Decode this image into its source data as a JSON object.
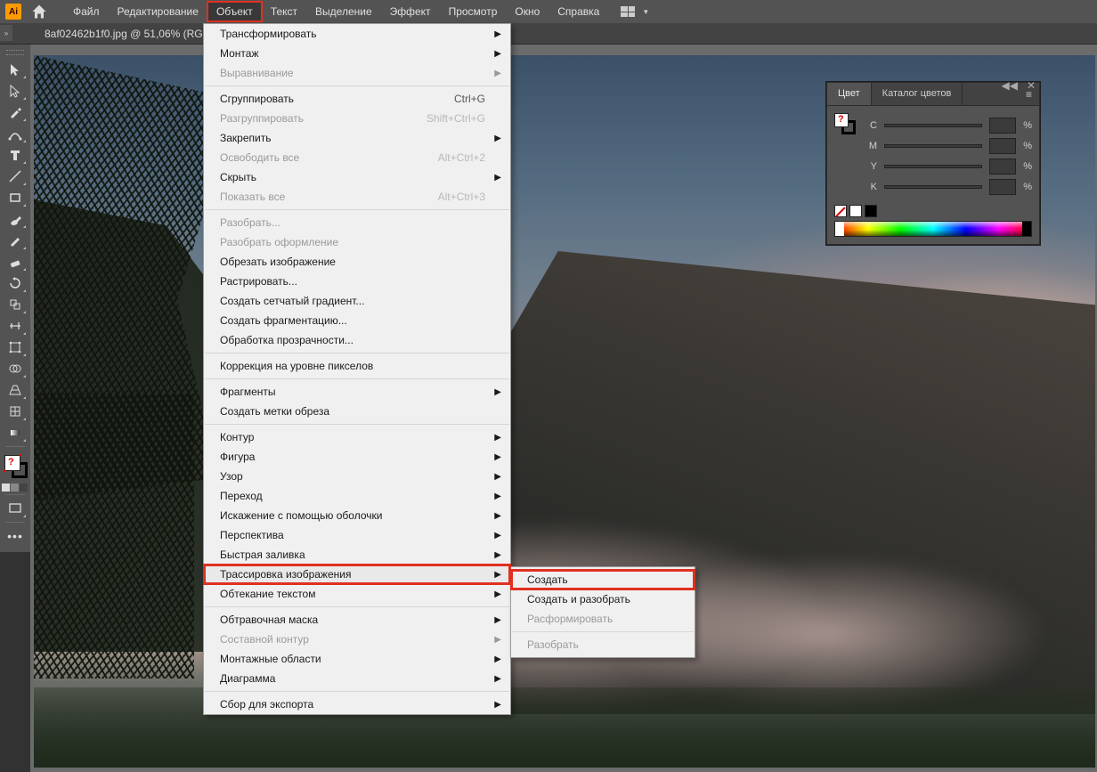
{
  "menubar": {
    "items": [
      "Файл",
      "Редактирование",
      "Объект",
      "Текст",
      "Выделение",
      "Эффект",
      "Просмотр",
      "Окно",
      "Справка"
    ],
    "active_index": 2
  },
  "document": {
    "tab_title": "8af02462b1f0.jpg @ 51,06% (RGB/"
  },
  "object_menu": {
    "groups": [
      [
        {
          "label": "Трансформировать",
          "submenu": true
        },
        {
          "label": "Монтаж",
          "submenu": true
        },
        {
          "label": "Выравнивание",
          "submenu": true,
          "disabled": true
        }
      ],
      [
        {
          "label": "Сгруппировать",
          "shortcut": "Ctrl+G"
        },
        {
          "label": "Разгруппировать",
          "shortcut": "Shift+Ctrl+G",
          "disabled": true
        },
        {
          "label": "Закрепить",
          "submenu": true
        },
        {
          "label": "Освободить все",
          "shortcut": "Alt+Ctrl+2",
          "disabled": true
        },
        {
          "label": "Скрыть",
          "submenu": true
        },
        {
          "label": "Показать все",
          "shortcut": "Alt+Ctrl+3",
          "disabled": true
        }
      ],
      [
        {
          "label": "Разобрать...",
          "disabled": true
        },
        {
          "label": "Разобрать оформление",
          "disabled": true
        },
        {
          "label": "Обрезать изображение"
        },
        {
          "label": "Растрировать..."
        },
        {
          "label": "Создать сетчатый градиент..."
        },
        {
          "label": "Создать фрагментацию..."
        },
        {
          "label": "Обработка прозрачности..."
        }
      ],
      [
        {
          "label": "Коррекция на уровне пикселов"
        }
      ],
      [
        {
          "label": "Фрагменты",
          "submenu": true
        },
        {
          "label": "Создать метки обреза"
        }
      ],
      [
        {
          "label": "Контур",
          "submenu": true
        },
        {
          "label": "Фигура",
          "submenu": true
        },
        {
          "label": "Узор",
          "submenu": true
        },
        {
          "label": "Переход",
          "submenu": true
        },
        {
          "label": "Искажение с помощью оболочки",
          "submenu": true
        },
        {
          "label": "Перспектива",
          "submenu": true
        },
        {
          "label": "Быстрая заливка",
          "submenu": true
        },
        {
          "label": "Трассировка изображения",
          "submenu": true,
          "highlighted": true,
          "hover": true
        },
        {
          "label": "Обтекание текстом",
          "submenu": true
        }
      ],
      [
        {
          "label": "Обтравочная маска",
          "submenu": true
        },
        {
          "label": "Составной контур",
          "submenu": true,
          "disabled": true
        },
        {
          "label": "Монтажные области",
          "submenu": true
        },
        {
          "label": "Диаграмма",
          "submenu": true
        }
      ],
      [
        {
          "label": "Сбор для экспорта",
          "submenu": true
        }
      ]
    ]
  },
  "trace_submenu": {
    "items": [
      {
        "label": "Создать",
        "highlighted": true
      },
      {
        "label": "Создать и разобрать"
      },
      {
        "label": "Расформировать",
        "disabled": true
      },
      {
        "label": "__sep"
      },
      {
        "label": "Разобрать",
        "disabled": true
      }
    ]
  },
  "color_panel": {
    "tab_color": "Цвет",
    "tab_guide": "Каталог цветов",
    "sliders": [
      "C",
      "M",
      "Y",
      "K"
    ],
    "unit": "%"
  },
  "tools": [
    "selection",
    "direct-selection",
    "pen",
    "curvature",
    "type",
    "line",
    "rectangle",
    "brush",
    "pencil",
    "eraser",
    "rotate",
    "scale",
    "width",
    "free-transform",
    "shape-builder",
    "perspective",
    "mesh",
    "gradient",
    "eyedropper",
    "blend",
    "symbol",
    "column-graph",
    "artboard",
    "slice",
    "hand",
    "zoom"
  ]
}
